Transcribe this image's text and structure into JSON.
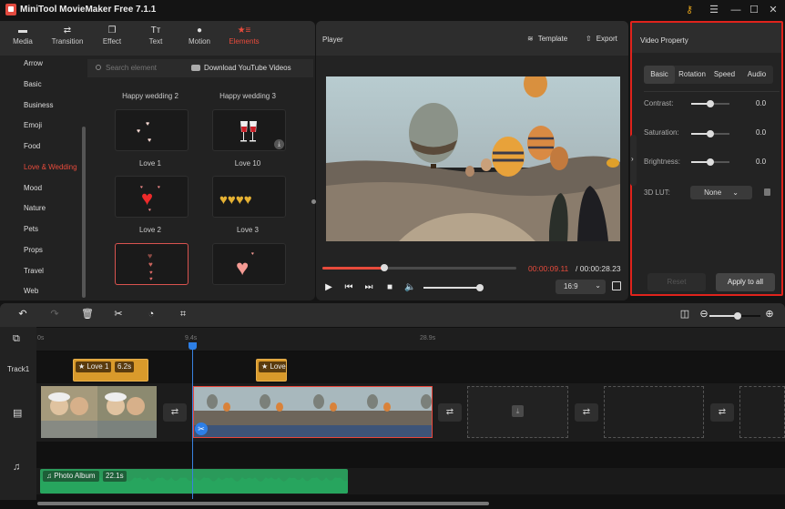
{
  "app": {
    "title": "MiniTool MovieMaker Free 7.1.1",
    "window_controls": [
      "key-icon",
      "menu-icon",
      "minimize-icon",
      "maximize-icon",
      "close-icon"
    ]
  },
  "library": {
    "tabs": [
      {
        "label": "Media",
        "icon": "folder-icon"
      },
      {
        "label": "Transition",
        "icon": "swap-icon"
      },
      {
        "label": "Effect",
        "icon": "layers-icon"
      },
      {
        "label": "Text",
        "icon": "text-icon"
      },
      {
        "label": "Motion",
        "icon": "motion-icon"
      },
      {
        "label": "Elements",
        "icon": "elements-icon",
        "active": true
      }
    ],
    "categories": [
      "Arrow",
      "Basic",
      "Business",
      "Emoji",
      "Food",
      "Love & Wedding",
      "Mood",
      "Nature",
      "Pets",
      "Props",
      "Travel",
      "Web"
    ],
    "active_category": "Love & Wedding",
    "search_placeholder": "Search element",
    "youtube_link": "Download YouTube Videos",
    "elements": [
      {
        "label": "Happy wedding 2"
      },
      {
        "label": "Happy wedding 3",
        "downloadable": true
      },
      {
        "label": "Love 1"
      },
      {
        "label": "Love 10"
      },
      {
        "label": "Love 2",
        "selected": true
      },
      {
        "label": "Love 3"
      }
    ]
  },
  "player": {
    "title": "Player",
    "template_label": "Template",
    "export_label": "Export",
    "time_current": "00:00:09.11",
    "time_total": "/ 00:00:28.23",
    "progress_fraction": 0.32,
    "volume_fraction": 1.0,
    "aspect_ratio": "16:9"
  },
  "video_property": {
    "title": "Video Property",
    "tabs": [
      "Basic",
      "Rotation",
      "Speed",
      "Audio"
    ],
    "active_tab": "Basic",
    "rows": [
      {
        "label": "Contrast:",
        "value": "0.0",
        "fraction": 0.5
      },
      {
        "label": "Saturation:",
        "value": "0.0",
        "fraction": 0.5
      },
      {
        "label": "Brightness:",
        "value": "0.0",
        "fraction": 0.5
      }
    ],
    "lut_label": "3D LUT:",
    "lut_value": "None",
    "reset_label": "Reset",
    "apply_label": "Apply to all"
  },
  "timeline": {
    "ruler_ticks": [
      "0s",
      "9.4s",
      "28.9s"
    ],
    "playhead": "9.4s",
    "zoom_fraction": 0.55,
    "track1_label": "Track1",
    "element_clips": [
      {
        "label": "Love 1",
        "duration": "6.2s"
      },
      {
        "label": "Love"
      }
    ],
    "audio_clip": {
      "label": "Photo Album",
      "duration": "22.1s"
    }
  },
  "colors": {
    "accent": "#e84b3c",
    "playhead": "#2d7fe6",
    "element_clip": "#d99a2b",
    "audio_clip": "#2a9a5a",
    "highlight_border": "#e0231c"
  }
}
